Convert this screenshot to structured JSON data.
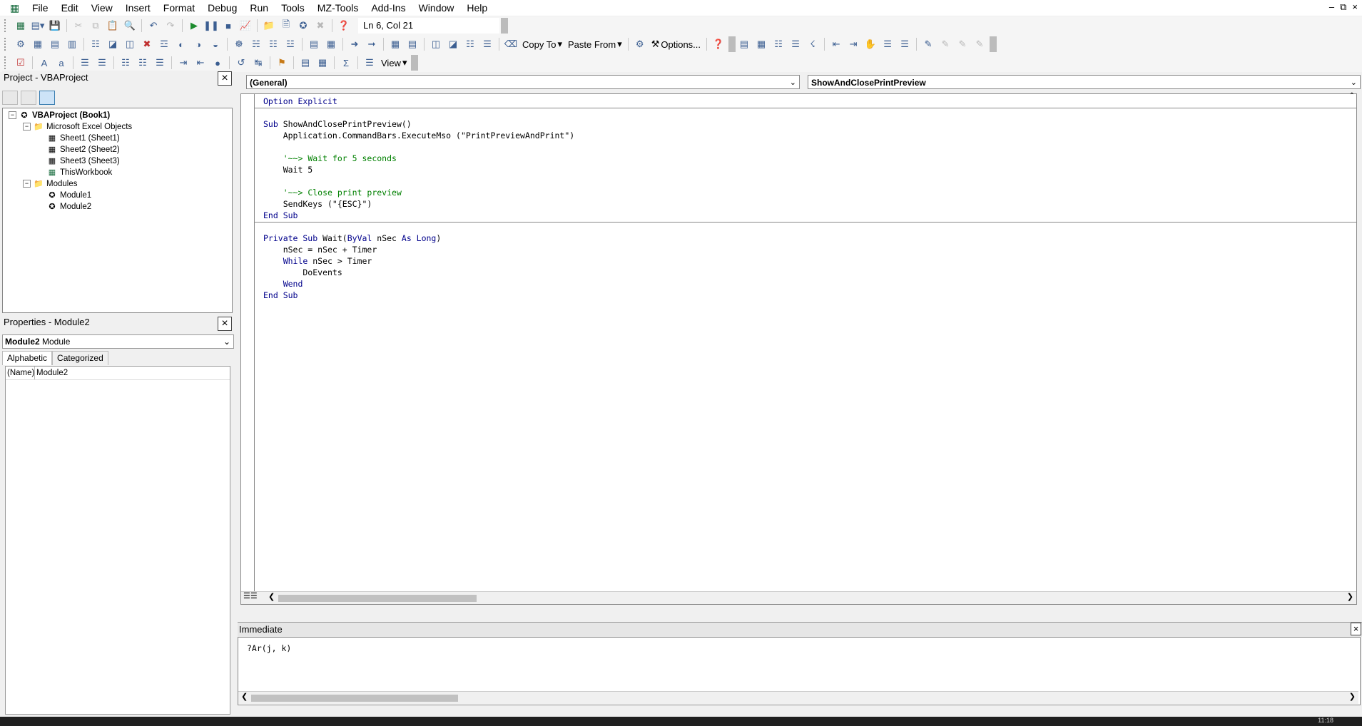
{
  "menu": [
    "File",
    "Edit",
    "View",
    "Insert",
    "Format",
    "Debug",
    "Run",
    "Tools",
    "MZ-Tools",
    "Add-Ins",
    "Window",
    "Help"
  ],
  "window_controls": {
    "minimize": "–",
    "restore": "⧉",
    "close": "×"
  },
  "toolbar1": {
    "cursor_position": "Ln 6, Col 21"
  },
  "toolbar2": {
    "copy_to": "Copy To",
    "paste_from": "Paste From",
    "options": "Options..."
  },
  "toolbar3": {
    "view": "View"
  },
  "project_panel": {
    "title": "Project - VBAProject",
    "root": "VBAProject (Book1)",
    "folder_objects": "Microsoft Excel Objects",
    "objects": [
      "Sheet1 (Sheet1)",
      "Sheet2 (Sheet2)",
      "Sheet3 (Sheet3)",
      "ThisWorkbook"
    ],
    "folder_modules": "Modules",
    "modules": [
      "Module1",
      "Module2"
    ]
  },
  "properties_panel": {
    "title": "Properties - Module2",
    "object_name": "Module2",
    "object_type": "Module",
    "tabs": [
      "Alphabetic",
      "Categorized"
    ],
    "rows": [
      {
        "key": "(Name)",
        "value": "Module2"
      }
    ]
  },
  "code_window": {
    "object_combo": "(General)",
    "procedure_combo": "ShowAndClosePrintPreview"
  },
  "code_lines": [
    [
      [
        "kw",
        "Option Explicit"
      ]
    ],
    [],
    [
      [
        "kw",
        "Sub "
      ],
      [
        "t",
        "ShowAndClosePrintPreview()"
      ]
    ],
    [
      [
        "t",
        "    Application.CommandBars.ExecuteMso (\"PrintPreviewAndPrint\")"
      ]
    ],
    [],
    [
      [
        "t",
        "    "
      ],
      [
        "cm",
        "'~~> Wait for 5 seconds"
      ]
    ],
    [
      [
        "t",
        "    Wait 5"
      ]
    ],
    [],
    [
      [
        "t",
        "    "
      ],
      [
        "cm",
        "'~~> Close print preview"
      ]
    ],
    [
      [
        "t",
        "    SendKeys (\"{ESC}\")"
      ]
    ],
    [
      [
        "kw",
        "End Sub"
      ]
    ],
    [],
    [
      [
        "kw",
        "Private Sub "
      ],
      [
        "t",
        "Wait("
      ],
      [
        "kw",
        "ByVal "
      ],
      [
        "t",
        "nSec "
      ],
      [
        "kw",
        "As Long"
      ],
      [
        "t",
        ")"
      ]
    ],
    [
      [
        "t",
        "    nSec = nSec + Timer"
      ]
    ],
    [
      [
        "t",
        "    "
      ],
      [
        "kw",
        "While "
      ],
      [
        "t",
        "nSec > Timer"
      ]
    ],
    [
      [
        "t",
        "        DoEvents"
      ]
    ],
    [
      [
        "t",
        "    "
      ],
      [
        "kw",
        "Wend"
      ]
    ],
    [
      [
        "kw",
        "End Sub"
      ]
    ]
  ],
  "immediate": {
    "title": "Immediate",
    "text": "?Ar(j, k)"
  },
  "taskbar": {
    "clock": "11:18"
  }
}
